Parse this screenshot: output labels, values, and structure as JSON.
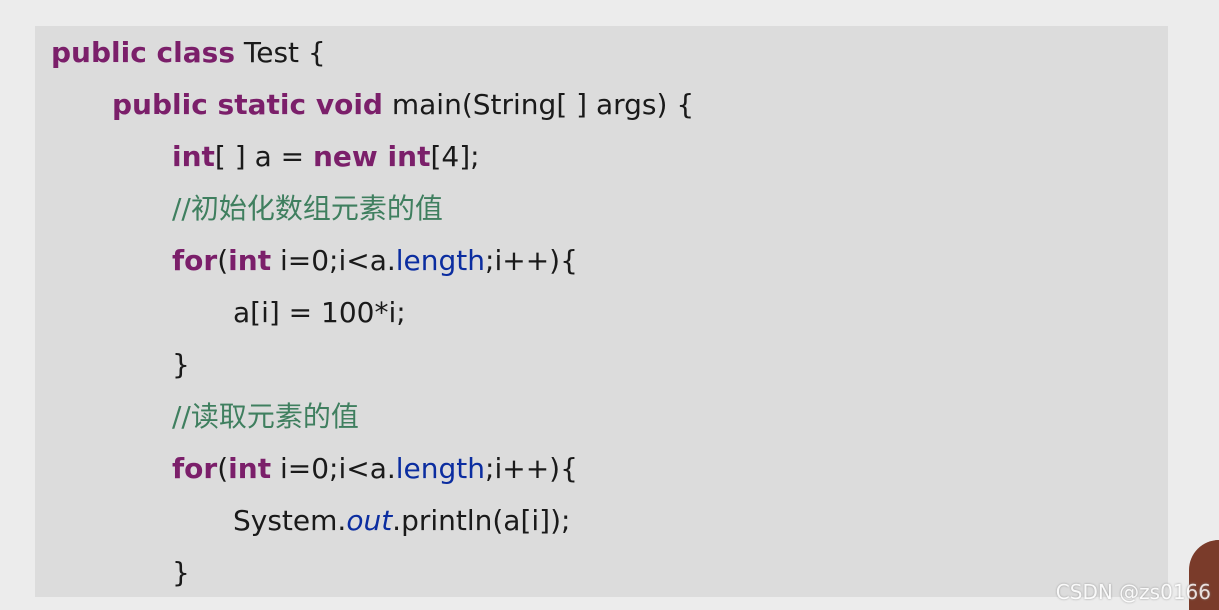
{
  "code": {
    "line1": {
      "kw": "public class",
      "rest": " Test {"
    },
    "line2": {
      "kw": "public static void",
      "rest": " main(String[ ] args) {"
    },
    "line3": {
      "kw1": "int",
      "mid": "[ ] a = ",
      "kw2": "new int",
      "rest": "[4];"
    },
    "line4": {
      "comment": "//初始化数组元素的值"
    },
    "line5": {
      "kw1": "for",
      "p1": "(",
      "kw2": "int",
      "p2": " i=0;i<a.",
      "field": "length",
      "p3": ";i++){"
    },
    "line6": {
      "text": "a[i] = 100*i;"
    },
    "line7": {
      "text": "}"
    },
    "line8": {
      "comment": "//读取元素的值"
    },
    "line9": {
      "kw1": "for",
      "p1": "(",
      "kw2": "int",
      "p2": " i=0;i<a.",
      "field": "length",
      "p3": ";i++){"
    },
    "line10": {
      "p1": "System.",
      "static_field": "out",
      "p2": ".println(a[i]);"
    },
    "line11": {
      "text": "}"
    }
  },
  "watermark": "CSDN @zs0166",
  "colors": {
    "keyword": "#7b1f6a",
    "comment": "#3f7f5f",
    "field": "#0b2da0",
    "panel": "#dcdcdc",
    "page": "#ececec"
  }
}
